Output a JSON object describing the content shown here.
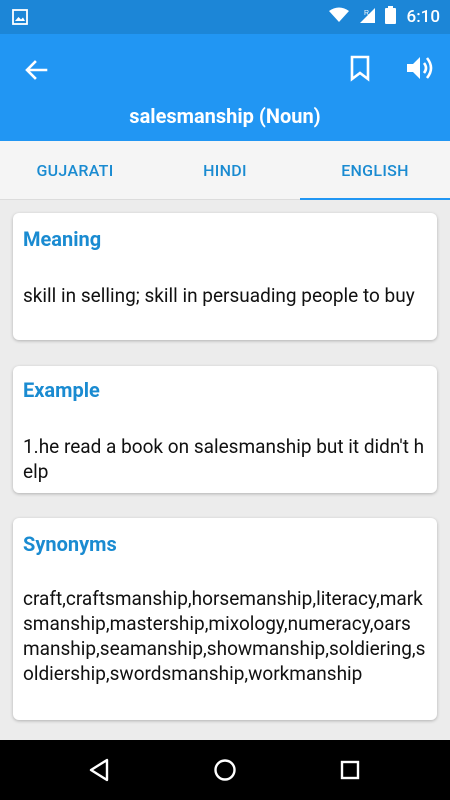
{
  "status": {
    "time": "6:10"
  },
  "app": {
    "title": "salesmanship (Noun)"
  },
  "tabs": [
    {
      "label": "GUJARATI"
    },
    {
      "label": "HINDI"
    },
    {
      "label": "ENGLISH"
    }
  ],
  "cards": {
    "meaning": {
      "heading": "Meaning",
      "text": "skill in selling; skill in persuading people to buy"
    },
    "example": {
      "heading": "Example",
      "text": "1.he read a book on salesmanship but it didn't help"
    },
    "synonyms": {
      "heading": "Synonyms",
      "text": "craft,craftsmanship,horsemanship,literacy,marksmanship,mastership,mixology,numeracy,oarsmanship,seamanship,showmanship,soldiering,soldiership,swordsmanship,workmanship"
    }
  },
  "icons": {
    "status_left": "image-icon",
    "wifi": "wifi-icon",
    "signal": "signal-icon",
    "battery": "battery-icon",
    "back": "arrow-back-icon",
    "bookmark": "bookmark-icon",
    "volume": "volume-icon",
    "nav_back": "nav-back-icon",
    "nav_home": "nav-home-icon",
    "nav_recents": "nav-recents-icon"
  },
  "colors": {
    "status_bar": "#1c86d7",
    "app_bar": "#2196f3",
    "accent": "#1a8bd1",
    "background": "#ececec"
  }
}
